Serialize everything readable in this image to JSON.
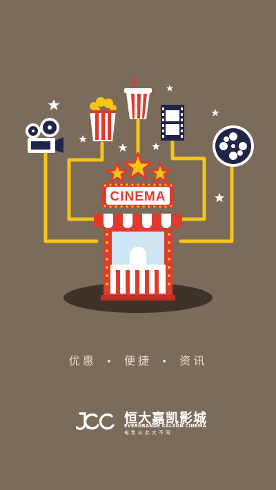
{
  "illustration": {
    "sign_text": "CINEMA",
    "colors": {
      "background": "#7b6b5b",
      "red": "#e03a2f",
      "yellow": "#f5c518",
      "navy": "#1f2547",
      "white": "#ffffff"
    },
    "icons": [
      "film-projector-icon",
      "popcorn-icon",
      "drink-cup-icon",
      "film-strip-icon",
      "film-reel-icon",
      "ticket-booth-icon"
    ]
  },
  "tagline": {
    "item1": "优惠",
    "separator": "•",
    "item2": "便捷",
    "item3": "资讯"
  },
  "brand": {
    "name_cn": "恒大嘉凯影城",
    "name_en": "EVERGRANDE CALXON CINEMA",
    "sub_cn": "电影从此大不同"
  }
}
